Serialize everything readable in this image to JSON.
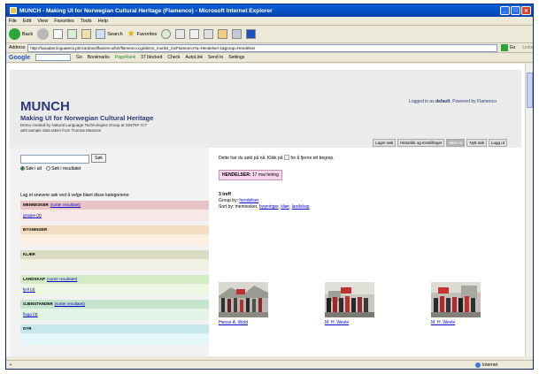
{
  "window": {
    "title": "MUNCH - Making UI for Norwegian Cultural Heritage (Flamenco) - Microsoft Internet Explorer"
  },
  "menu": [
    "File",
    "Edit",
    "View",
    "Favorites",
    "Tools",
    "Help"
  ],
  "toolbar": {
    "back": "Back",
    "search": "Search",
    "favorites": "Favorites"
  },
  "address": {
    "label": "Address",
    "url": "http://lusiadas.linguateca.pt/ncardoso/flamenco/bin/flamenco.cgi/demo_munk2_no/Flamenco?a=Hendelser:1&group=Hendelser",
    "go": "Go",
    "links": "Links"
  },
  "googlebar": {
    "logo": "Google",
    "go": "Go",
    "bookmarks": "Bookmarks",
    "pagerank": "PageRank",
    "blocked": "37 blocked",
    "check": "Check",
    "autolink": "AutoLink",
    "sendto": "Send to",
    "settings": "Settings"
  },
  "page": {
    "title": "MUNCH",
    "subtitle": "Making UI for Norwegian Cultural Heritage",
    "desc_line1": "Demo created by Natural Language Technologies Group at SINTEF ICT",
    "desc_line2": "with sample data taken from Tromsø Museum",
    "login_prefix": "Logged in as",
    "login_user": "default",
    "powered": "Powered by Flamenco",
    "nav": [
      "Lagre søk",
      "Historikk og innstillinger",
      "Skriv ut",
      "Nytt søk",
      "Logg ut"
    ]
  },
  "search": {
    "button": "Søk",
    "opt_all": "Søk i alt",
    "opt_results": "Søk i resultatet"
  },
  "categories_intro": "Lag et snevere søk ved å velge blant disse kategoriene:",
  "categories": [
    {
      "name": "MENNESKER",
      "sort": "(sorter resultatet)",
      "item": "gruppe",
      "count": "(3)",
      "head_color": "#e8c4c4",
      "body_color": "#f8e8e8"
    },
    {
      "name": "BYGNINGER",
      "sort": "",
      "item": "",
      "count": "",
      "head_color": "#f4dcc0",
      "body_color": "#fcf0e4"
    },
    {
      "name": "KLÆR",
      "sort": "",
      "item": "",
      "count": "",
      "head_color": "#dcdcc4",
      "body_color": "#f0f0e4"
    },
    {
      "name": "LANDSKAP",
      "sort": "(sorter resultatet)",
      "item": "fjell",
      "count": "(3)",
      "head_color": "#d4ecc4",
      "body_color": "#ecf8e4"
    },
    {
      "name": "GJENSTANDER",
      "sort": "(sorter resultatet)",
      "item": "flagg",
      "count": "(3)",
      "head_color": "#c4e4cc",
      "body_color": "#e4f4e8"
    },
    {
      "name": "DYR",
      "sort": "",
      "item": "",
      "count": "",
      "head_color": "#c4e8ec",
      "body_color": "#e4f6f8"
    }
  ],
  "results": {
    "hint": "Dette har du søkt på nå. Klikk på",
    "hint_end": "for å fjerne ett begrep.",
    "filter_label": "HENDELSER:",
    "filter_value": "17 mai feiring",
    "count": "3 treff",
    "group_prefix": "Group by:",
    "group_value": "hendelser",
    "sort_prefix": "Sort by: mennesker,",
    "sort_links": [
      "bygninger",
      "klær",
      "landskap"
    ],
    "items": [
      {
        "caption": "Hense A. Wold"
      },
      {
        "caption": "M. H. Wevle"
      },
      {
        "caption": "M. H. Wevle"
      }
    ]
  },
  "status": {
    "zone": "Internet"
  }
}
